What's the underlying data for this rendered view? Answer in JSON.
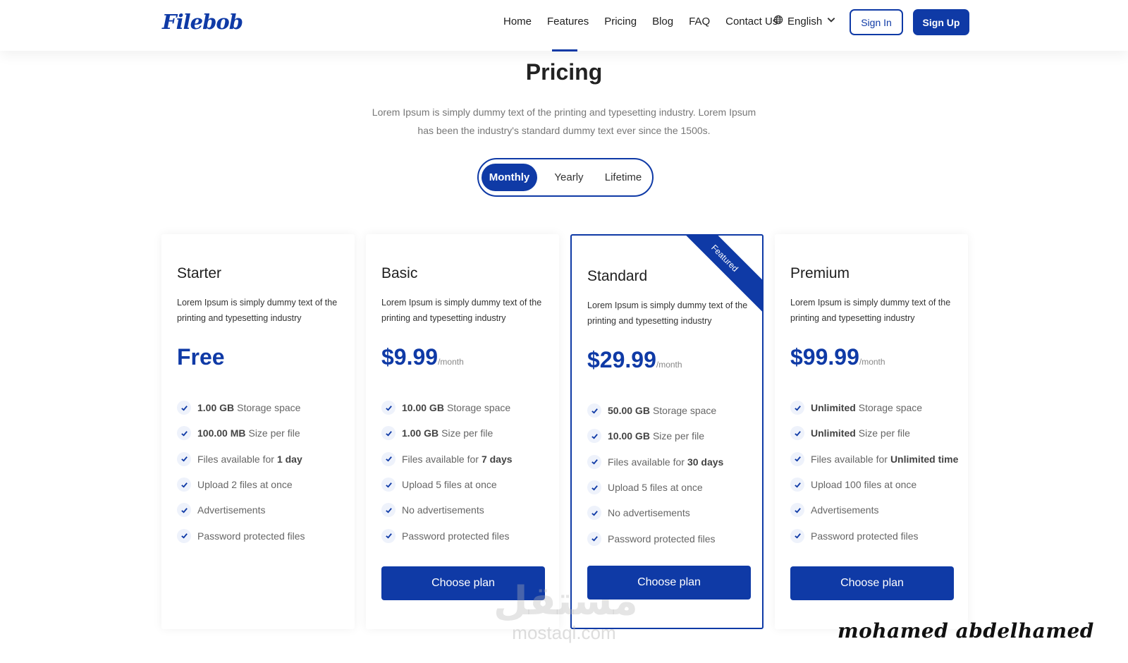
{
  "brand": {
    "logo_text": "Filebob",
    "primary_color": "#0f3aa6"
  },
  "nav": {
    "links": [
      "Home",
      "Features",
      "Pricing",
      "Blog",
      "FAQ",
      "Contact Us"
    ],
    "language": "English",
    "sign_in": "Sign In",
    "sign_up": "Sign Up"
  },
  "header": {
    "title": "Pricing",
    "subtitle": "Lorem Ipsum is simply dummy text of the printing and typesetting industry. Lorem Ipsum has been the industry's standard dummy text ever since the 1500s."
  },
  "billing_toggle": {
    "options": [
      "Monthly",
      "Yearly",
      "Lifetime"
    ],
    "selected": "Monthly"
  },
  "plans": [
    {
      "name": "Starter",
      "description": "Lorem Ipsum is simply dummy text of the printing and typesetting industry",
      "price": "Free",
      "period": "",
      "featured": false,
      "features": [
        {
          "bold": "1.00 GB",
          "text": "Storage space"
        },
        {
          "bold": "100.00 MB",
          "text": "Size per file"
        },
        {
          "text": "Files available for",
          "bold_after": "1 day"
        },
        {
          "text": "Upload 2 files at once"
        },
        {
          "text": "Advertisements"
        },
        {
          "text": "Password protected files"
        }
      ],
      "button": ""
    },
    {
      "name": "Basic",
      "description": "Lorem Ipsum is simply dummy text of the printing and typesetting industry",
      "price": "$9.99",
      "period": "/month",
      "featured": false,
      "features": [
        {
          "bold": "10.00 GB",
          "text": "Storage space"
        },
        {
          "bold": "1.00 GB",
          "text": "Size per file"
        },
        {
          "text": "Files available for",
          "bold_after": "7 days"
        },
        {
          "text": "Upload 5 files at once"
        },
        {
          "text": "No advertisements"
        },
        {
          "text": "Password protected files"
        }
      ],
      "button": "Choose plan"
    },
    {
      "name": "Standard",
      "description": "Lorem Ipsum is simply dummy text of the printing and typesetting industry",
      "price": "$29.99",
      "period": "/month",
      "featured": true,
      "ribbon": "Featured",
      "features": [
        {
          "bold": "50.00 GB",
          "text": "Storage space"
        },
        {
          "bold": "10.00 GB",
          "text": "Size per file"
        },
        {
          "text": "Files available for",
          "bold_after": "30 days"
        },
        {
          "text": "Upload 5 files at once"
        },
        {
          "text": "No advertisements"
        },
        {
          "text": "Password protected files"
        }
      ],
      "button": "Choose plan"
    },
    {
      "name": "Premium",
      "description": "Lorem Ipsum is simply dummy text of the printing and typesetting industry",
      "price": "$99.99",
      "period": "/month",
      "featured": false,
      "features": [
        {
          "bold": "Unlimited",
          "text": "Storage space"
        },
        {
          "bold": "Unlimited",
          "text": "Size per file"
        },
        {
          "text": "Files available for",
          "bold_after": "Unlimited time"
        },
        {
          "text": "Upload 100 files at once"
        },
        {
          "text": "Advertisements"
        },
        {
          "text": "Password protected files"
        }
      ],
      "button": "Choose plan"
    }
  ],
  "watermarks": {
    "arabic": "مستقل",
    "latin": "mostaql.com",
    "author": "mohamed abdelhamed"
  }
}
